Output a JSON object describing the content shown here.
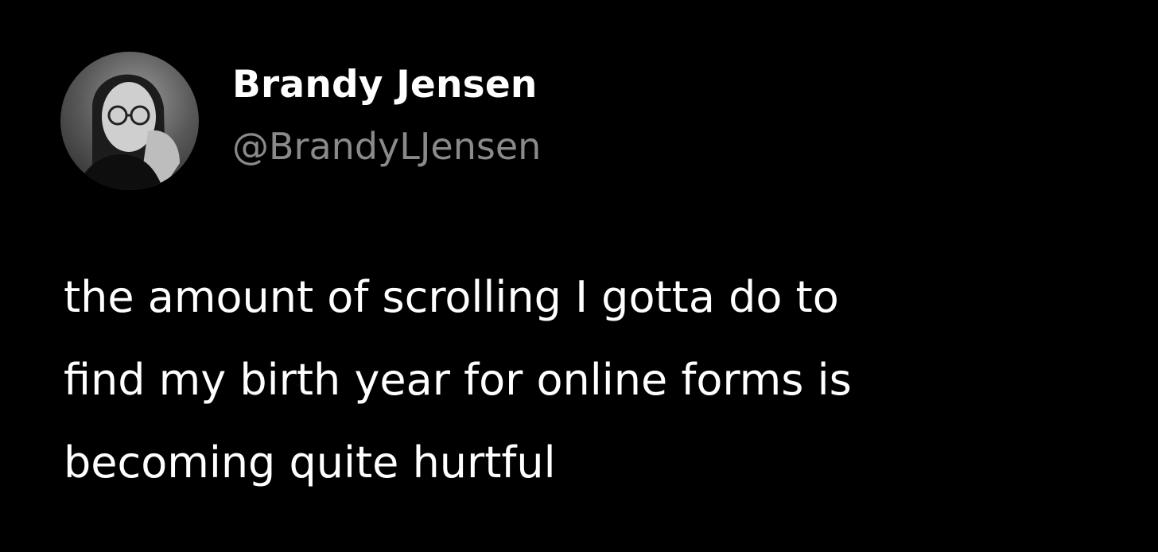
{
  "tweet": {
    "author": {
      "display_name": "Brandy Jensen",
      "handle": "@BrandyLJensen",
      "avatar_icon": "profile-photo-avatar"
    },
    "text_lines": [
      "the amount of scrolling I gotta do to",
      "find my birth year for online forms is",
      "becoming quite hurtful"
    ]
  },
  "colors": {
    "background": "#000000",
    "primary_text": "#ffffff",
    "secondary_text": "#8a8a8a"
  }
}
